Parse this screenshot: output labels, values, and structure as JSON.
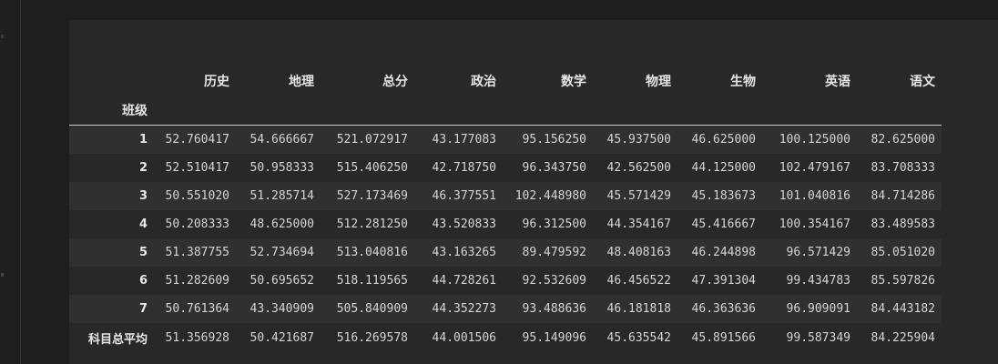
{
  "table": {
    "index_name": "班级",
    "columns": [
      "历史",
      "地理",
      "总分",
      "政治",
      "数学",
      "物理",
      "生物",
      "英语",
      "语文"
    ],
    "rows": [
      {
        "index": "1",
        "values": [
          "52.760417",
          "54.666667",
          "521.072917",
          "43.177083",
          "95.156250",
          "45.937500",
          "46.625000",
          "100.125000",
          "82.625000"
        ]
      },
      {
        "index": "2",
        "values": [
          "52.510417",
          "50.958333",
          "515.406250",
          "42.718750",
          "96.343750",
          "42.562500",
          "44.125000",
          "102.479167",
          "83.708333"
        ]
      },
      {
        "index": "3",
        "values": [
          "50.551020",
          "51.285714",
          "527.173469",
          "46.377551",
          "102.448980",
          "45.571429",
          "45.183673",
          "101.040816",
          "84.714286"
        ]
      },
      {
        "index": "4",
        "values": [
          "50.208333",
          "48.625000",
          "512.281250",
          "43.520833",
          "96.312500",
          "44.354167",
          "45.416667",
          "100.354167",
          "83.489583"
        ]
      },
      {
        "index": "5",
        "values": [
          "51.387755",
          "52.734694",
          "513.040816",
          "43.163265",
          "89.479592",
          "48.408163",
          "46.244898",
          "96.571429",
          "85.051020"
        ]
      },
      {
        "index": "6",
        "values": [
          "51.282609",
          "50.695652",
          "518.119565",
          "44.728261",
          "92.532609",
          "46.456522",
          "47.391304",
          "99.434783",
          "85.597826"
        ]
      },
      {
        "index": "7",
        "values": [
          "50.761364",
          "43.340909",
          "505.840909",
          "44.352273",
          "93.488636",
          "46.181818",
          "46.363636",
          "96.909091",
          "84.443182"
        ]
      },
      {
        "index": "科目总平均",
        "values": [
          "51.356928",
          "50.421687",
          "516.269578",
          "44.001506",
          "95.149096",
          "45.635542",
          "45.891566",
          "99.587349",
          "84.225904"
        ]
      }
    ]
  }
}
